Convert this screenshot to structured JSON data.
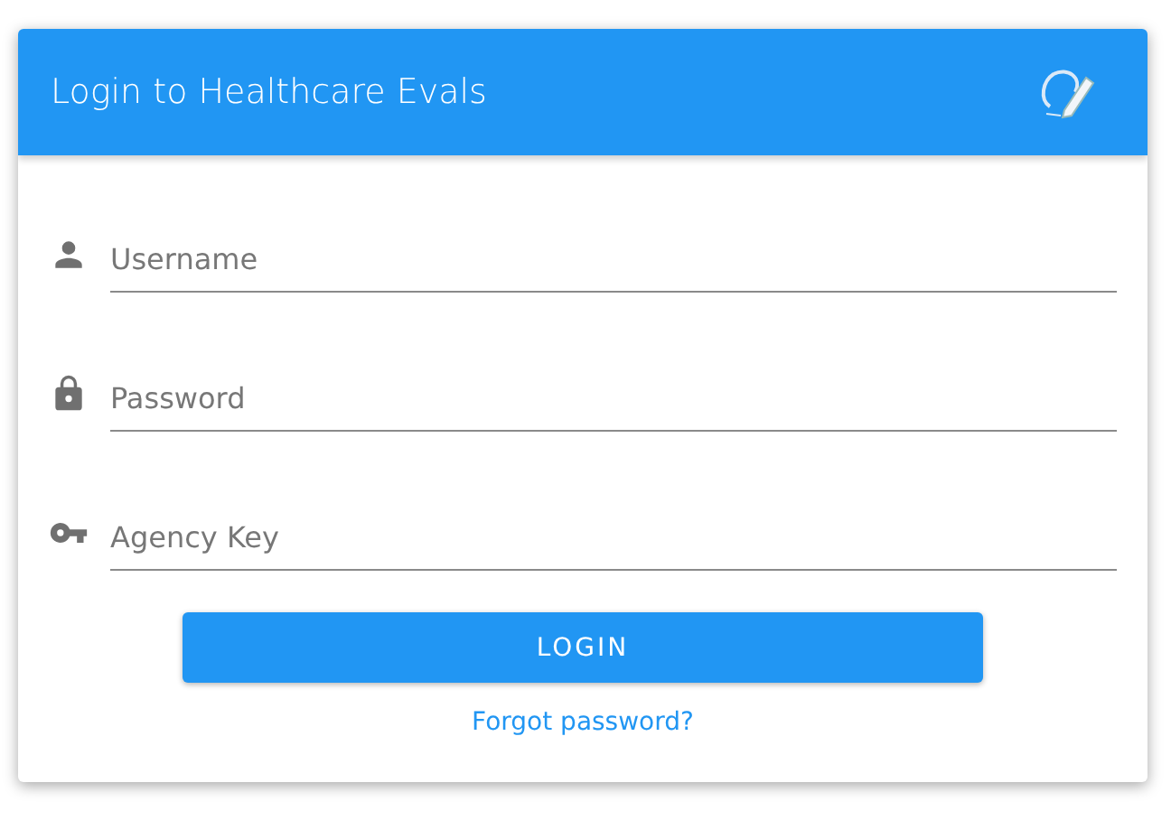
{
  "header": {
    "title": "Login to Healthcare Evals"
  },
  "fields": [
    {
      "kind": "user",
      "placeholder": "Username"
    },
    {
      "kind": "password",
      "placeholder": "Password"
    },
    {
      "kind": "key",
      "placeholder": "Agency Key"
    }
  ],
  "login_button": "LOGIN",
  "forgot_link": "Forgot password?"
}
